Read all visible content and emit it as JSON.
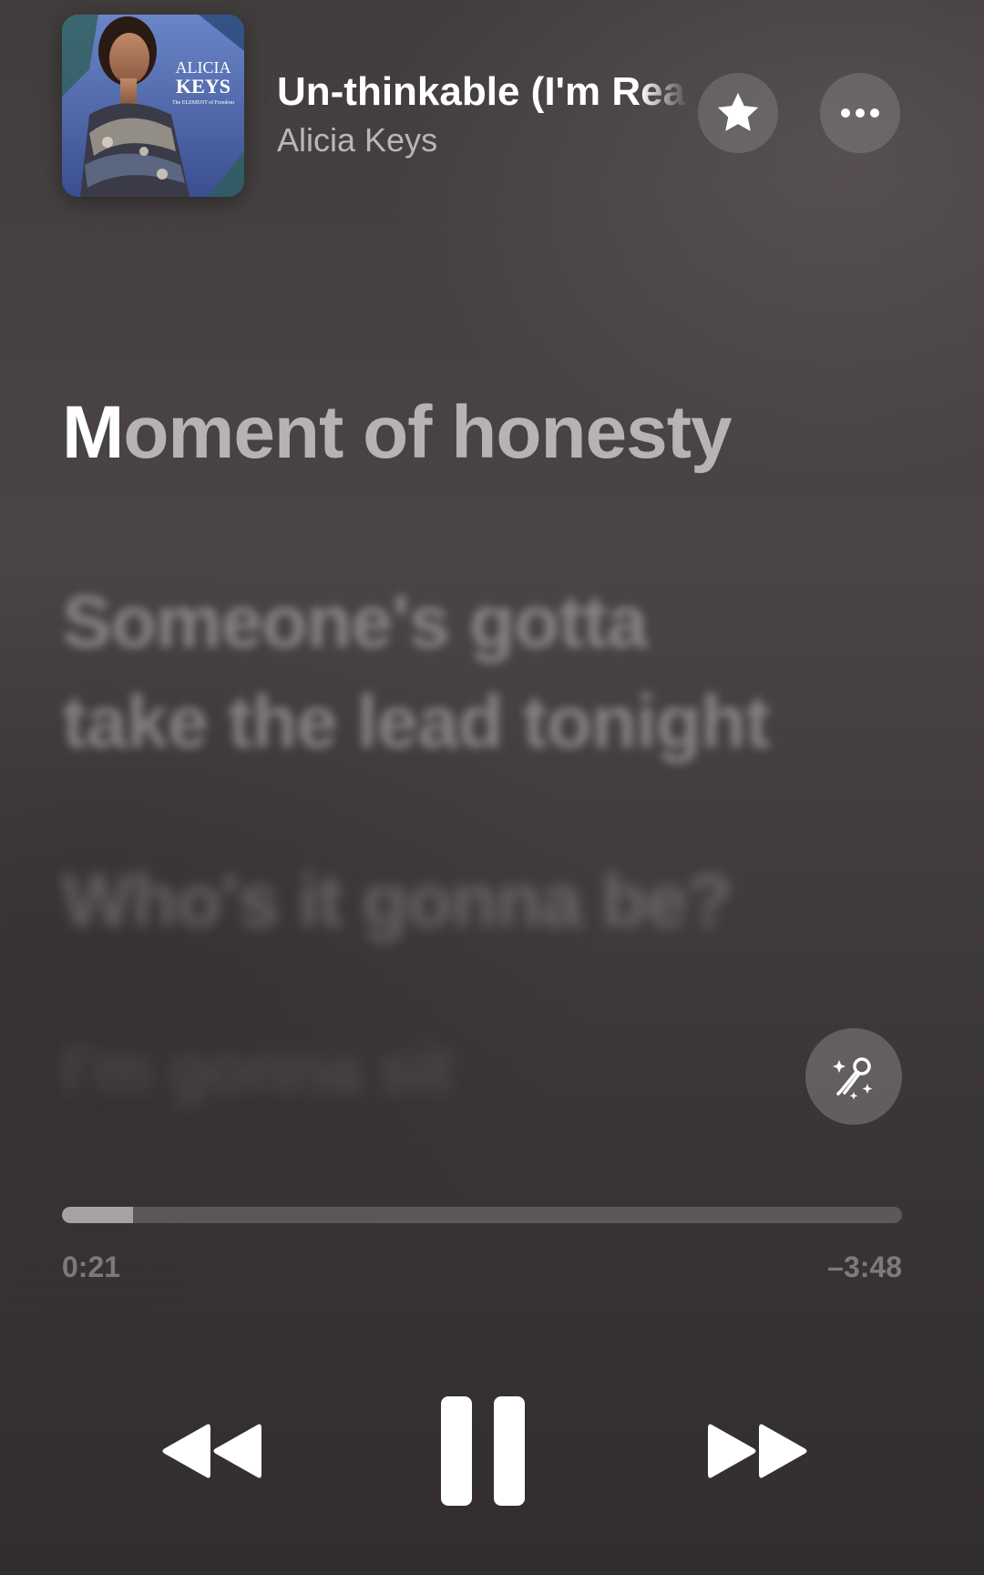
{
  "now_playing": {
    "title": "Un-thinkable (I'm Ready)",
    "artist": "Alicia Keys",
    "album_art": {
      "text_line1": "ALICIA",
      "text_line2": "KEYS",
      "text_line3": "The ELEMENT of Freedom"
    }
  },
  "header_buttons": {
    "favorite_icon": "star-icon",
    "more_icon": "ellipsis-icon"
  },
  "lyrics": {
    "current_sung": "M",
    "current_rest": "oment of honesty",
    "next_line_1": "Someone's gotta",
    "next_line_2": "take the lead tonight",
    "next_line_3": "Who's it gonna be?",
    "next_line_4": "I'm gonna sit"
  },
  "sing_button_icon": "microphone-sparkles-icon",
  "playback": {
    "elapsed": "0:21",
    "remaining": "–3:48",
    "progress_fraction": 0.085
  },
  "transport": {
    "rewind_icon": "rewind-icon",
    "pause_icon": "pause-icon",
    "forward_icon": "fast-forward-icon"
  },
  "colors": {
    "background": "#423d3d",
    "text_primary": "#ffffff"
  }
}
